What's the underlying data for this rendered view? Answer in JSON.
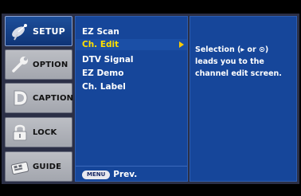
{
  "tabs": [
    {
      "label": "SETUP",
      "icon": "satellite-dish-icon",
      "active": true
    },
    {
      "label": "OPTION",
      "icon": "wrench-icon",
      "active": false
    },
    {
      "label": "CAPTION",
      "icon": "caption-d-icon",
      "active": false
    },
    {
      "label": "LOCK",
      "icon": "padlock-icon",
      "active": false
    },
    {
      "label": "GUIDE",
      "icon": "remote-control-icon",
      "active": false
    }
  ],
  "menu": {
    "items": [
      {
        "label": "EZ Scan"
      },
      {
        "label": "Ch. Edit",
        "selected": true
      },
      {
        "label": "DTV Signal"
      },
      {
        "label": "EZ Demo"
      },
      {
        "label": "Ch. Label"
      }
    ],
    "footer": {
      "key": "MENU",
      "label": "Prev."
    }
  },
  "help": {
    "lines": [
      "Selection (▸ or ⊙)",
      "leads you to the",
      "channel edit screen."
    ]
  },
  "colors": {
    "panel": "#16469a",
    "selected_text": "#ffe000",
    "active_tab": "#0f3477",
    "frame": "#2b2f46"
  }
}
